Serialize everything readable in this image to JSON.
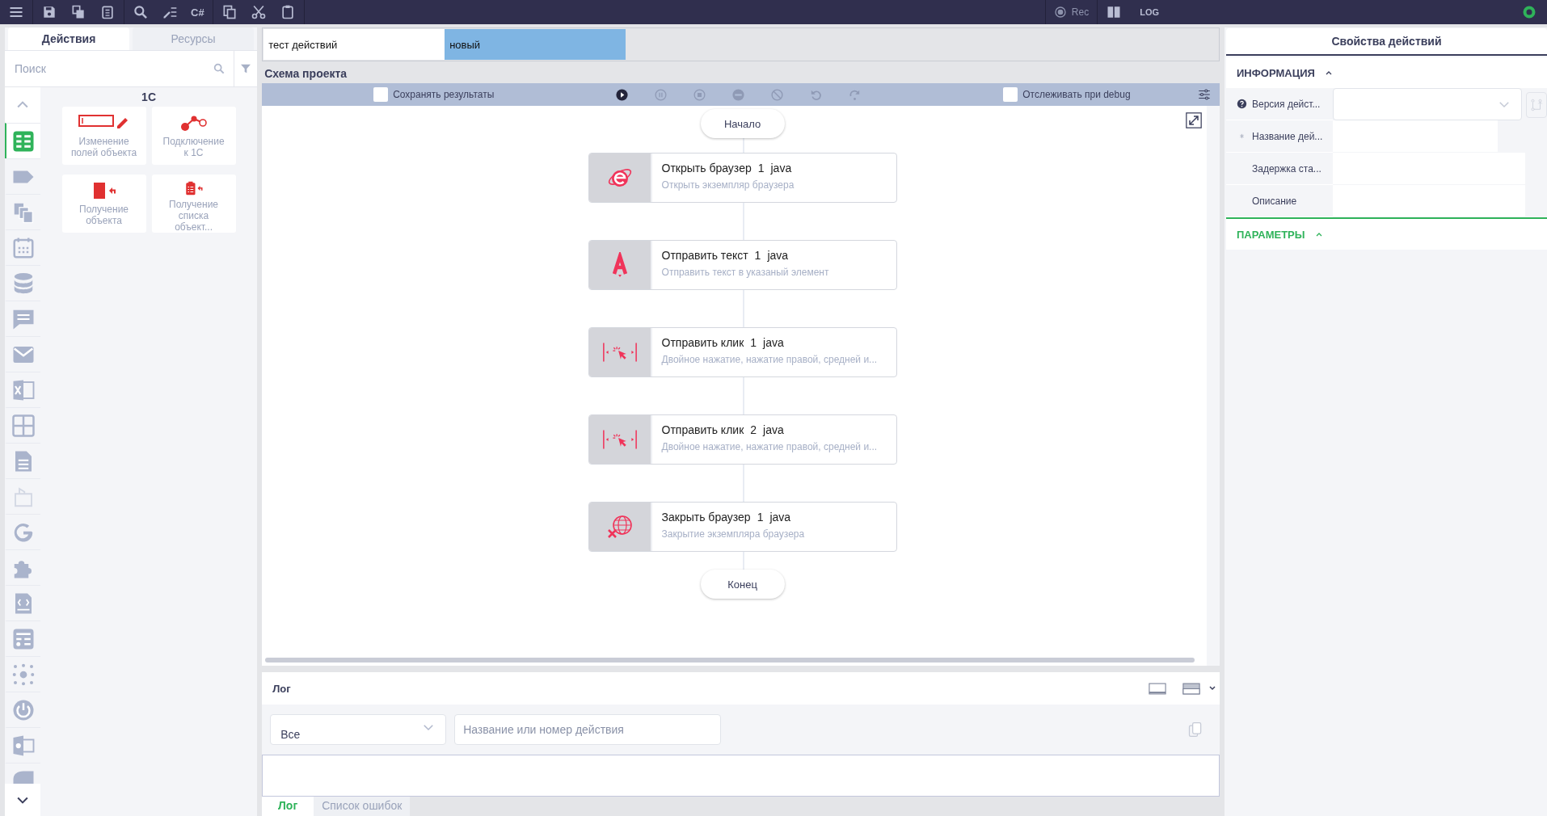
{
  "top_toolbar": {
    "csharp_label": "C#",
    "rec_label": "Rec",
    "log_label": "LOG"
  },
  "left_panel": {
    "tabs": [
      {
        "label": "Действия",
        "selected": true
      },
      {
        "label": "Ресурсы",
        "selected": false
      }
    ],
    "search": {
      "placeholder": "Поиск"
    },
    "category_icons": [
      {
        "selected": true
      },
      {
        "selected": false
      },
      {
        "selected": false
      },
      {
        "selected": false
      },
      {
        "selected": false
      },
      {
        "selected": false
      },
      {
        "selected": false
      },
      {
        "selected": false
      },
      {
        "selected": false
      },
      {
        "selected": false
      },
      {
        "selected": false
      },
      {
        "selected": false
      },
      {
        "selected": false
      },
      {
        "selected": false
      },
      {
        "selected": false
      },
      {
        "selected": false
      },
      {
        "selected": false
      },
      {
        "selected": false
      },
      {
        "selected": false
      }
    ],
    "group_title": "1С",
    "actions": [
      {
        "kind": "field-edit",
        "label": "Изменение полей объекта"
      },
      {
        "kind": "connect",
        "label": "Подключение к 1С"
      },
      {
        "kind": "get-object",
        "label": "Получение объекта"
      },
      {
        "kind": "get-list",
        "label": "Получение списка объект..."
      }
    ]
  },
  "document_tabs": [
    {
      "label": "тест действий",
      "selected": false
    },
    {
      "label": "новый",
      "selected": true
    }
  ],
  "schema": {
    "title": "Схема проекта",
    "save_results": {
      "label": "Сохранять результаты",
      "checked": false
    },
    "debug_trace": {
      "label": "Отслеживать при debug",
      "checked": false
    },
    "controls": [
      {
        "kind": "play",
        "disabled": false
      },
      {
        "kind": "pause",
        "disabled": true
      },
      {
        "kind": "stop",
        "disabled": true
      },
      {
        "kind": "minus",
        "disabled": true
      },
      {
        "kind": "block",
        "disabled": true
      },
      {
        "kind": "undo",
        "disabled": true
      },
      {
        "kind": "redo",
        "disabled": true
      }
    ],
    "start": "Начало",
    "end": "Конец",
    "steps": [
      {
        "kind": "browser",
        "title": "Открыть браузер",
        "number": "1",
        "language": "java",
        "description": "Открыть экземпляр браузера"
      },
      {
        "kind": "text",
        "title": "Отправить текст",
        "number": "1",
        "language": "java",
        "description": "Отправить текст в указаный элемент"
      },
      {
        "kind": "click",
        "title": "Отправить клик",
        "number": "1",
        "language": "java",
        "description": "Двойное нажатие, нажатие правой, средней и..."
      },
      {
        "kind": "click",
        "title": "Отправить клик",
        "number": "2",
        "language": "java",
        "description": "Двойное нажатие, нажатие правой, средней и..."
      },
      {
        "kind": "close-browser",
        "title": "Закрыть браузер",
        "number": "1",
        "language": "java",
        "description": "Закрытие экземпляра браузера"
      }
    ]
  },
  "log": {
    "title": "Лог",
    "filter": {
      "value": "Все"
    },
    "search": {
      "placeholder": "Название или номер действия"
    },
    "tabs": [
      {
        "label": "Лог",
        "selected": true
      },
      {
        "label": "Список ошибок",
        "selected": false
      }
    ]
  },
  "properties": {
    "title": "Свойства действий",
    "sections": [
      {
        "title": "ИНФОРМАЦИЯ",
        "active": false,
        "expanded": true,
        "fields": [
          {
            "kind": "select",
            "label": "Версия дейст...",
            "help": true,
            "required": false
          },
          {
            "kind": "text",
            "label": "Название дей...",
            "help": false,
            "required": true
          },
          {
            "kind": "text",
            "label": "Задержка ста...",
            "help": false,
            "required": false
          },
          {
            "kind": "text",
            "label": "Описание",
            "help": false,
            "required": false
          }
        ]
      },
      {
        "title": "ПАРАМЕТРЫ",
        "active": true,
        "expanded": true
      }
    ]
  }
}
